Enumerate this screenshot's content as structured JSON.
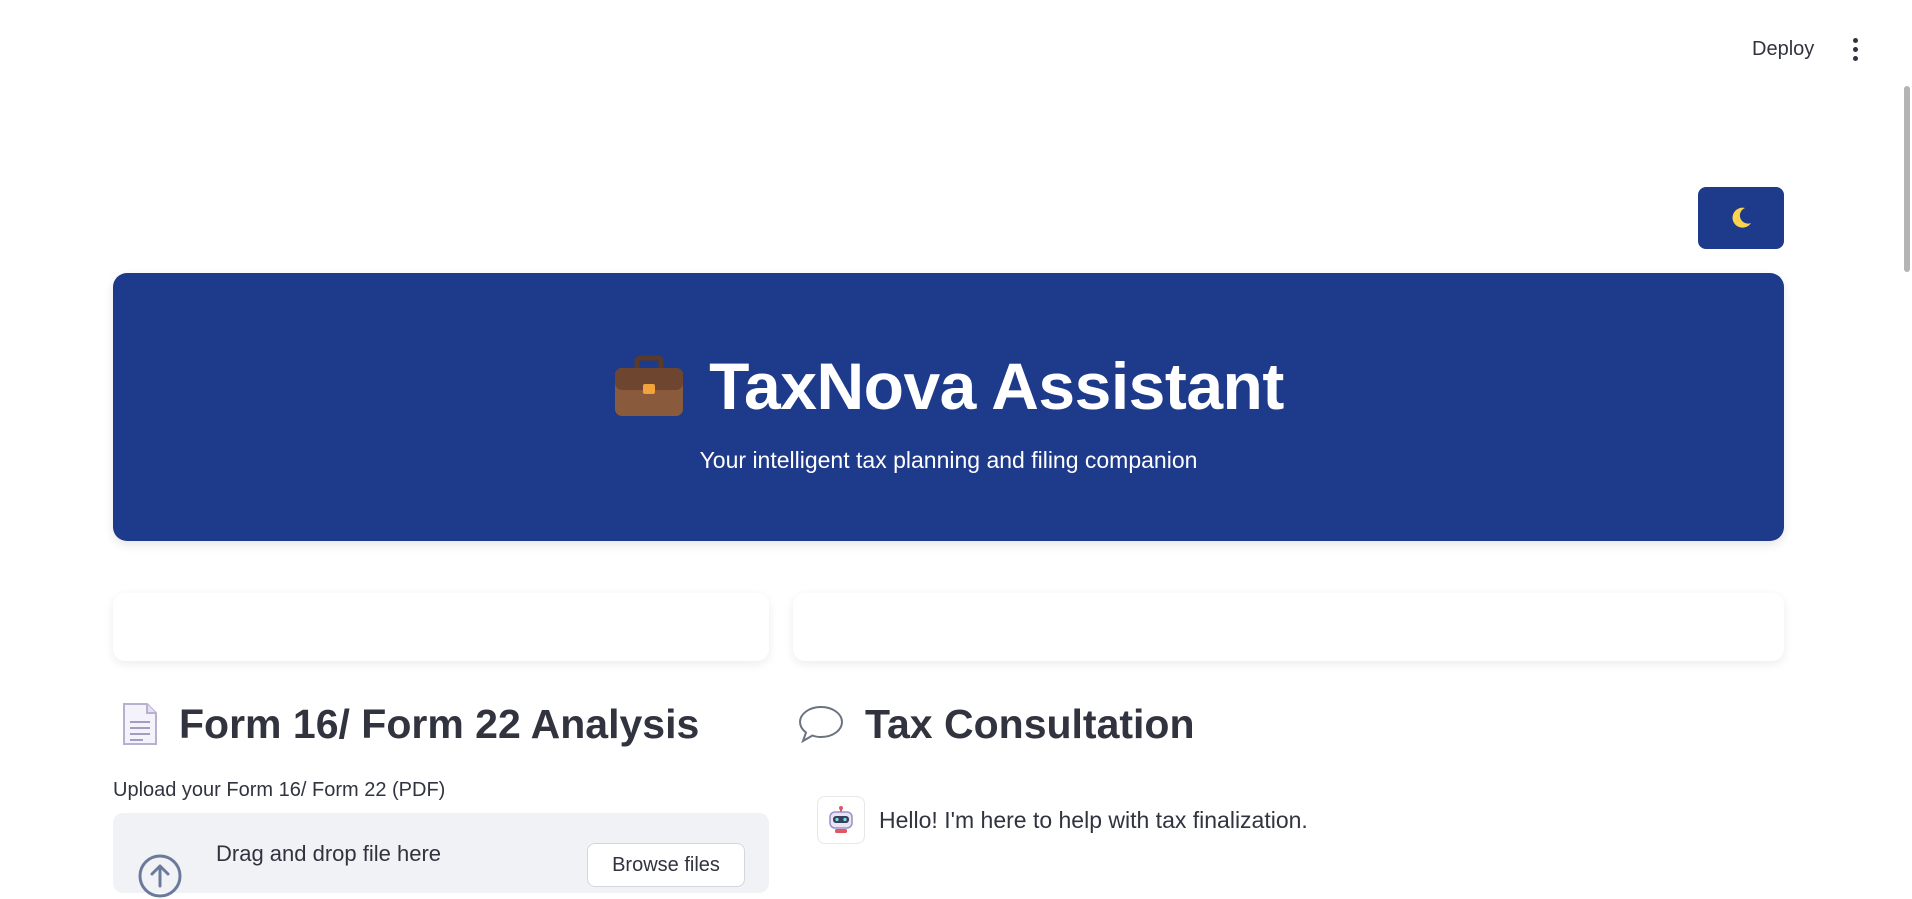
{
  "header": {
    "deploy_label": "Deploy",
    "menu_icon": "more-vertical-icon"
  },
  "theme_toggle": {
    "icon": "moon-icon",
    "accent": "#1e3a8a",
    "moon_color": "#fcd34d"
  },
  "hero": {
    "icon": "briefcase-icon",
    "title": "TaxNova Assistant",
    "subtitle": "Your intelligent tax planning and filing companion",
    "background": "#1e3a8a"
  },
  "form_section": {
    "icon": "document-icon",
    "title": "Form 16/ Form 22 Analysis",
    "upload_label": "Upload your Form 16/ Form 22 (PDF)",
    "dropzone_text": "Drag and drop file here",
    "upload_icon": "cloud-upload-icon",
    "browse_label": "Browse files"
  },
  "consultation_section": {
    "icon": "speech-bubble-icon",
    "title": "Tax Consultation",
    "messages": [
      {
        "role": "assistant",
        "avatar": "robot-icon",
        "text": "Hello! I'm here to help with tax finalization."
      }
    ]
  }
}
